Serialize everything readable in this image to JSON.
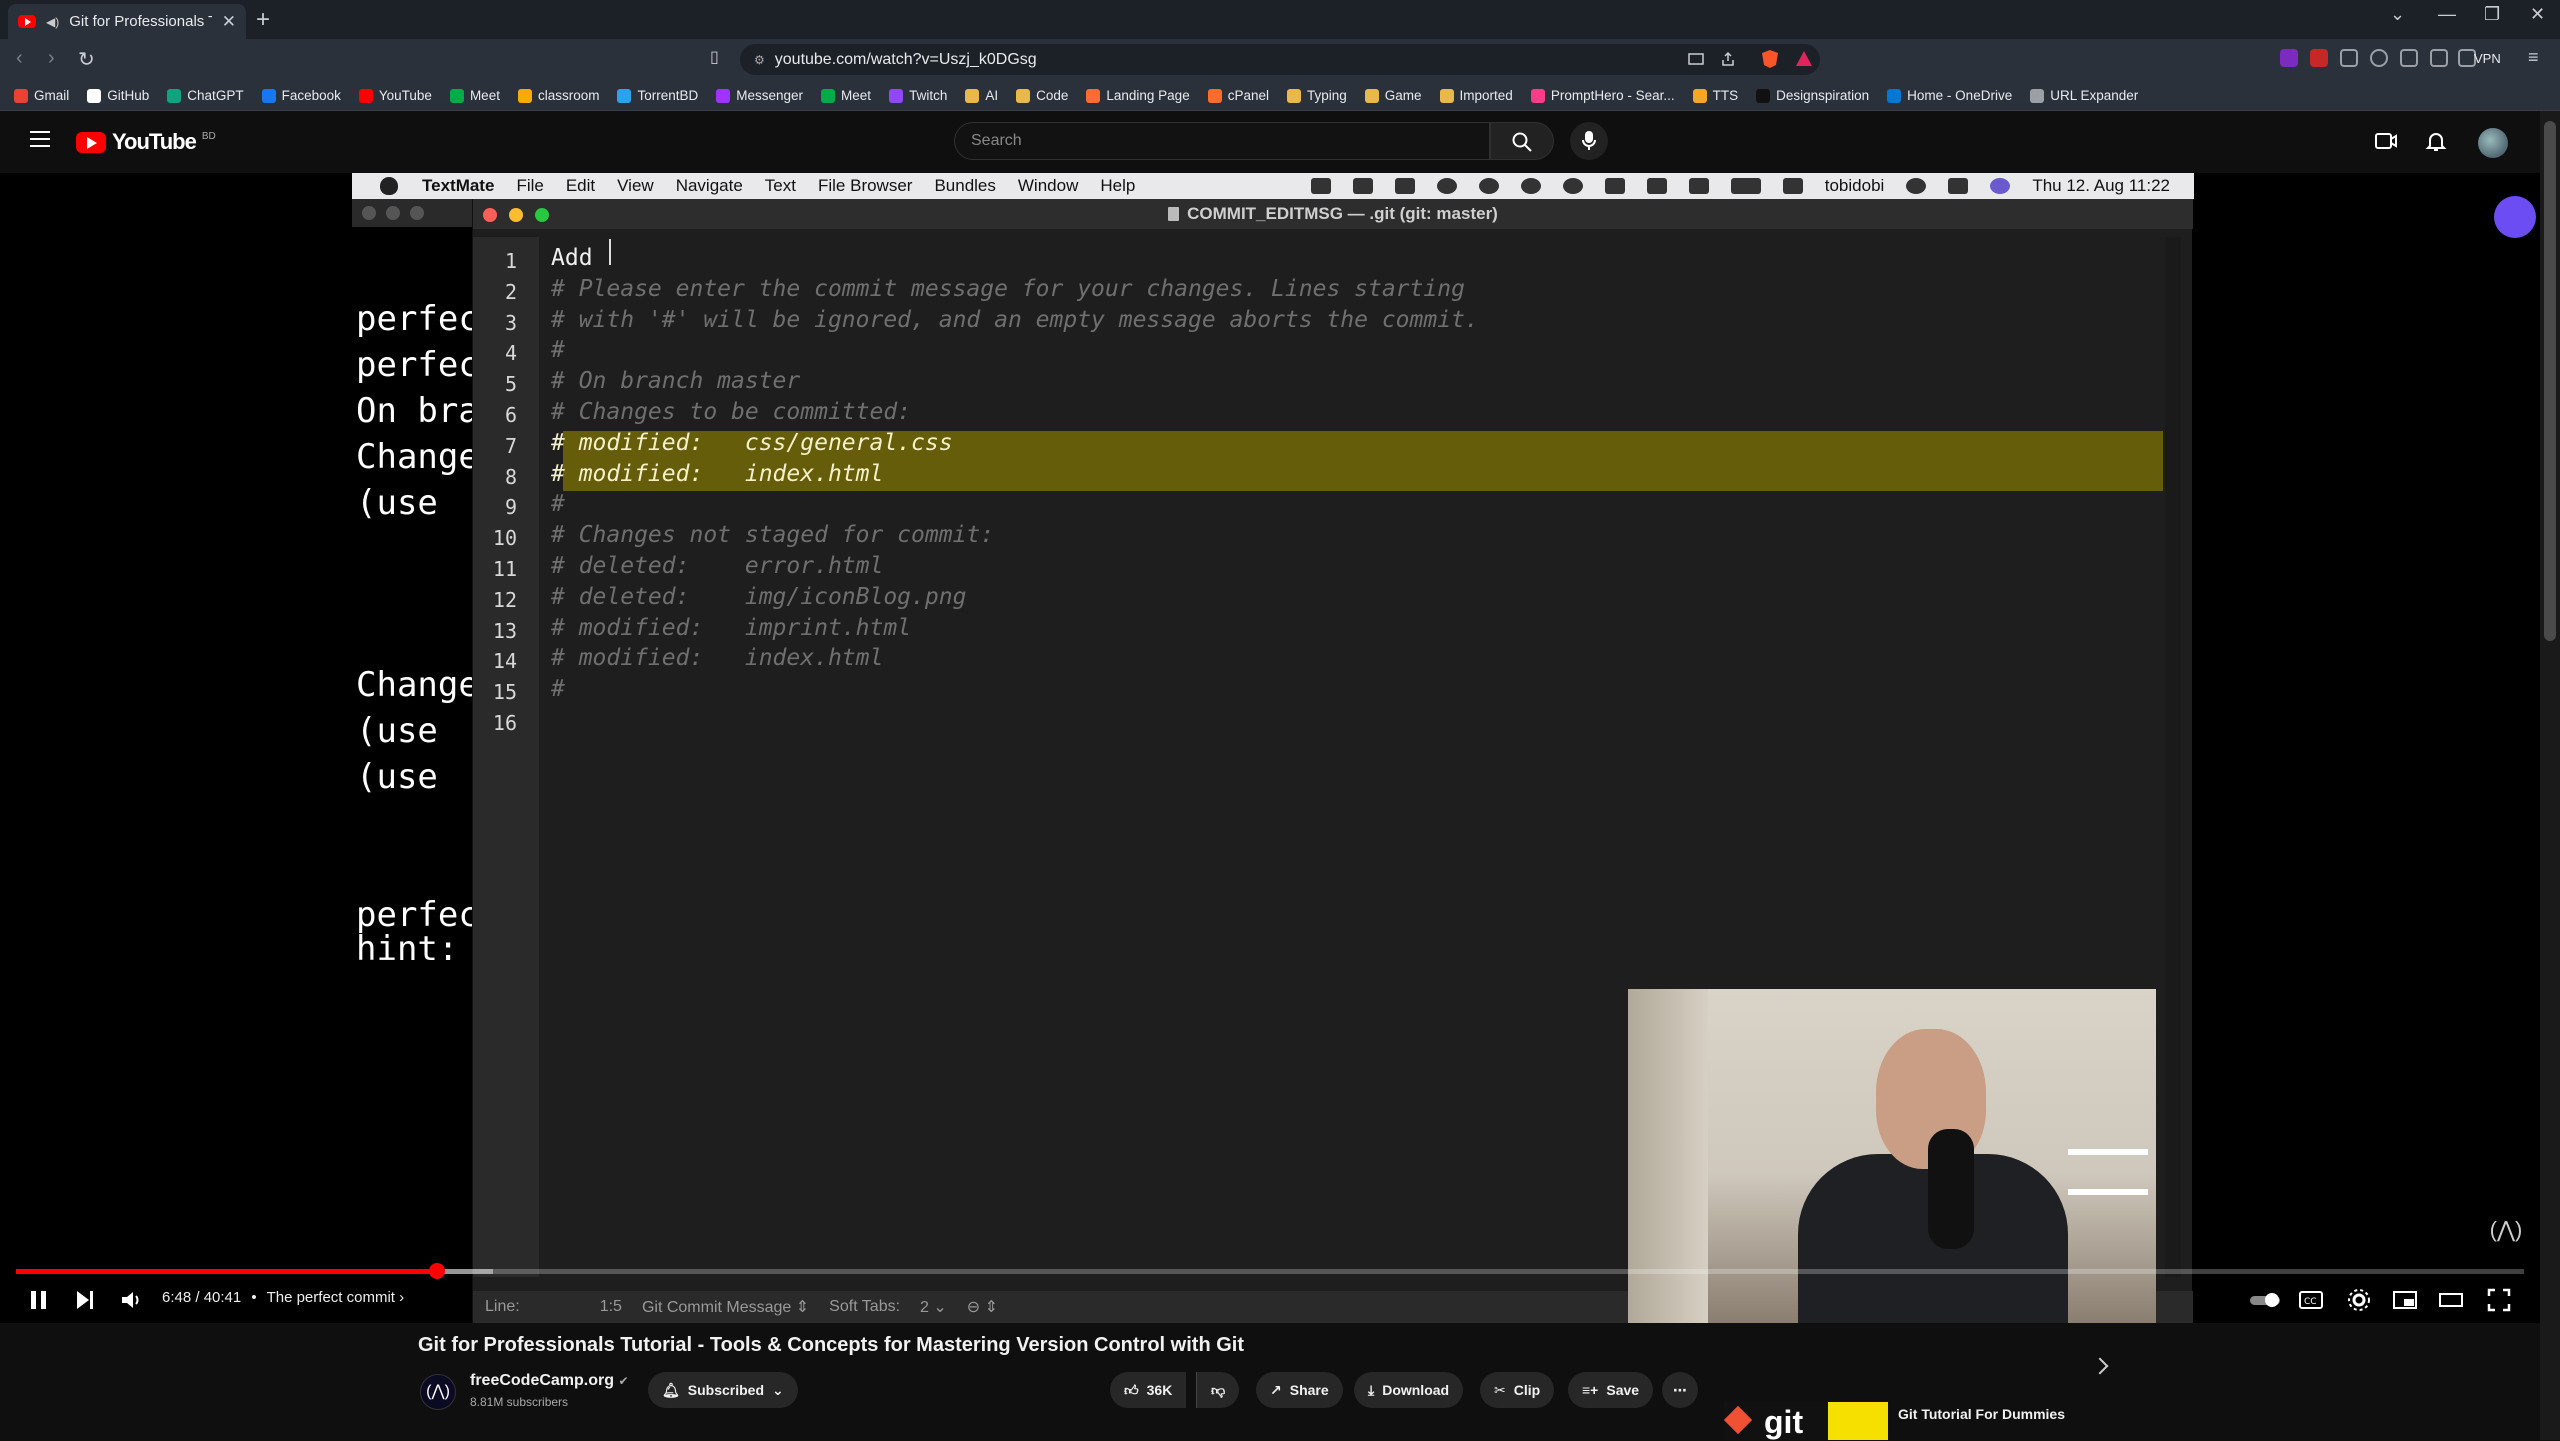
{
  "browser": {
    "tab_title": "Git for Professionals Tutorial",
    "url": "youtube.com/watch?v=Uszj_k0DGsg",
    "vpn_label": "VPN",
    "bookmarks": [
      "Gmail",
      "GitHub",
      "ChatGPT",
      "Facebook",
      "YouTube",
      "Meet",
      "classroom",
      "TorrentBD",
      "Messenger",
      "Meet",
      "Twitch",
      "AI",
      "Code",
      "Landing Page",
      "cPanel",
      "Typing",
      "Game",
      "Imported",
      "PromptHero - Sear...",
      "TTS",
      "Designspiration",
      "Home - OneDrive",
      "URL Expander"
    ],
    "bookmark_colors": [
      "#ea4335",
      "#ffffff",
      "#10a37f",
      "#1877f2",
      "#ff0000",
      "#00ac47",
      "#f9ab00",
      "#2aa3ef",
      "#a033ff",
      "#00ac47",
      "#9146ff",
      "#e8b84a",
      "#e8b84a",
      "#ff6b35",
      "#ff6c2c",
      "#e8b84a",
      "#e8b84a",
      "#e8b84a",
      "#ff3c8a",
      "#f5a623",
      "#111111",
      "#0078d4",
      "#9aa0a6"
    ]
  },
  "youtube": {
    "logo_text": "YouTube",
    "country_code": "BD",
    "search_placeholder": "Search"
  },
  "mac_menu": {
    "items": [
      "TextMate",
      "File",
      "Edit",
      "View",
      "Navigate",
      "Text",
      "File Browser",
      "Bundles",
      "Window",
      "Help"
    ],
    "user": "tobidobi",
    "clock": "Thu 12. Aug  11:22"
  },
  "background_terminal": {
    "lines": [
      "perfec",
      "perfec",
      "On bra",
      "Change",
      "  (use",
      "Change",
      "  (use",
      "  (use",
      "perfec",
      "hint:"
    ]
  },
  "textmate": {
    "window_title": "COMMIT_EDITMSG — .git (git: master)",
    "lines": [
      "Add ",
      "# Please enter the commit message for your changes. Lines starting",
      "# with '#' will be ignored, and an empty message aborts the commit.",
      "#",
      "# On branch master",
      "# Changes to be committed:",
      "# modified:   css/general.css",
      "# modified:   index.html",
      "#",
      "# Changes not staged for commit:",
      "# deleted:    error.html",
      "# deleted:    img/iconBlog.png",
      "# modified:   imprint.html",
      "# modified:   index.html",
      "#",
      ""
    ],
    "line_numbers": [
      "1",
      "2",
      "3",
      "4",
      "5",
      "6",
      "7",
      "8",
      "9",
      "10",
      "11",
      "12",
      "13",
      "14",
      "15",
      "16"
    ],
    "status": {
      "line_label": "Line:",
      "position": "1:5",
      "grammar": "Git Commit Message ⇕",
      "tabs": "Soft Tabs:",
      "tab_size": "2 ⌄",
      "symbol": "⊖ ⇕"
    }
  },
  "player": {
    "progress_fraction": 0.168,
    "buffered_fraction": 0.19,
    "current_time": "6:48",
    "duration": "40:41",
    "time_text": "6:48 / 40:41",
    "separator": "•",
    "chapter": "The perfect commit"
  },
  "video": {
    "title": "Git for Professionals Tutorial - Tools & Concepts for Mastering Version Control with Git",
    "channel": "freeCodeCamp.org",
    "subscribers": "8.81M subscribers",
    "subscribed_label": "Subscribed",
    "likes": "36K",
    "share_label": "Share",
    "download_label": "Download",
    "clip_label": "Clip",
    "save_label": "Save"
  },
  "related": {
    "thumb_text": "git",
    "title": "Git Tutorial For Dummies"
  },
  "colors": {
    "youtube_red": "#ff0000",
    "highlight_band": "#665d0a",
    "textmate_bg": "#1e1e1e"
  }
}
